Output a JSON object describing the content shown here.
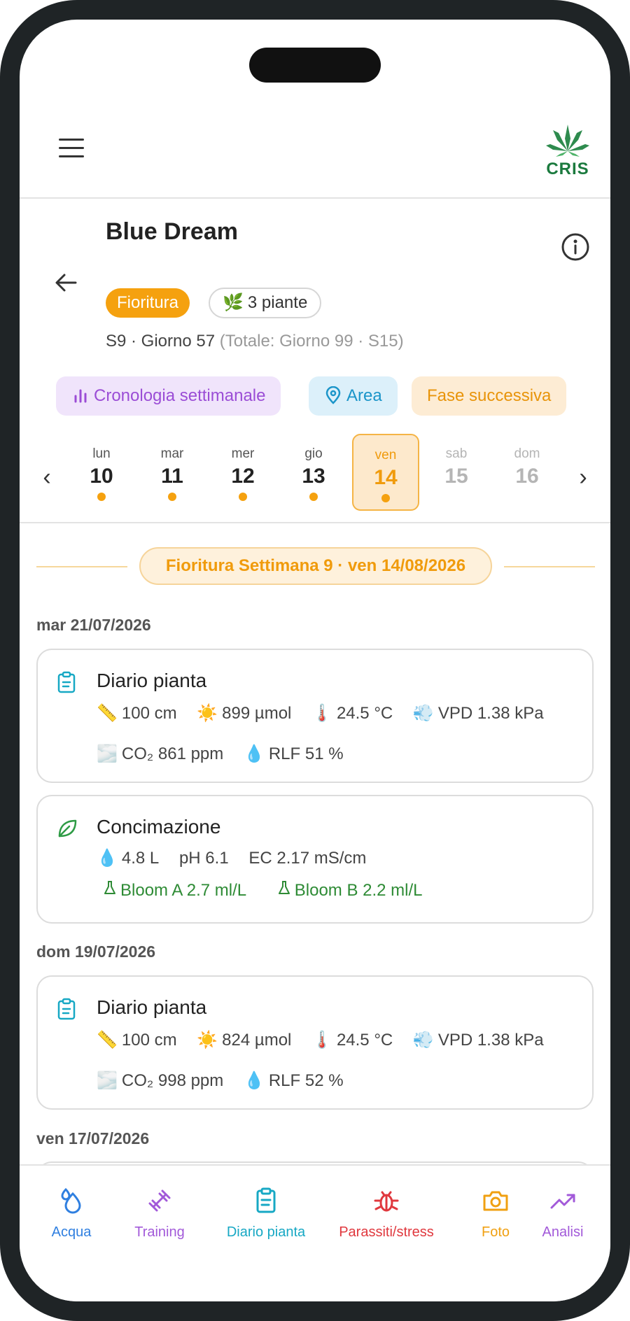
{
  "header": {
    "logo_text": "CRIS",
    "plant_name": "Blue Dream",
    "phase_badge": "Fioritura",
    "plants_badge": "3 piante",
    "plants_badge_emoji": "🌿",
    "day_info": "S9 · Giorno 57",
    "day_info_total": "(Totale: Giorno 99 · S15)"
  },
  "chips": {
    "timeline": "Cronologia settimanale",
    "area": "Area",
    "next_phase": "Fase successiva"
  },
  "week": {
    "prev_arrow": "‹",
    "next_arrow": "›",
    "days": [
      {
        "name": "lun",
        "num": "10",
        "has_entry": true
      },
      {
        "name": "mar",
        "num": "11",
        "has_entry": true
      },
      {
        "name": "mer",
        "num": "12",
        "has_entry": true
      },
      {
        "name": "gio",
        "num": "13",
        "has_entry": true
      },
      {
        "name": "ven",
        "num": "14",
        "has_entry": true,
        "selected": true
      },
      {
        "name": "sab",
        "num": "15",
        "has_entry": false
      },
      {
        "name": "dom",
        "num": "16",
        "has_entry": false
      }
    ]
  },
  "feed": {
    "week_banner": "Fioritura Settimana 9 · ven 14/08/2026",
    "groups": [
      {
        "date": "mar 21/07/2026",
        "entries": [
          {
            "title": "Diario pianta",
            "icon": "clipboard-icon",
            "height": "100 cm",
            "light": "899 µmol",
            "temp": "24.5 °C",
            "vpd": "VPD 1.38 kPa",
            "co2": "CO₂ 861 ppm",
            "rh": "RLF 51 %"
          },
          {
            "title": "Concimazione",
            "icon": "leaf-icon",
            "volume": "4.8 L",
            "ph": "pH 6.1",
            "ec": "EC 2.17 mS/cm",
            "nutrient_a": "Bloom A 2.7 ml/L",
            "nutrient_b": "Bloom B 2.2 ml/L"
          }
        ]
      },
      {
        "date": "dom 19/07/2026",
        "entries": [
          {
            "title": "Diario pianta",
            "icon": "clipboard-icon",
            "height": "100 cm",
            "light": "824 µmol",
            "temp": "24.5 °C",
            "vpd": "VPD 1.38 kPa",
            "co2": "CO₂ 998 ppm",
            "rh": "RLF 52 %"
          }
        ]
      },
      {
        "date": "ven 17/07/2026"
      }
    ],
    "emoji": {
      "ruler": "📏",
      "sun": "☀️",
      "thermo": "🌡️",
      "wind": "💨",
      "fog": "🌫️",
      "drop": "💧"
    }
  },
  "bottom_nav": [
    {
      "label": "Acqua",
      "color": "#2f7fe0"
    },
    {
      "label": "Training",
      "color": "#a259d9"
    },
    {
      "label": "Diario pianta",
      "color": "#17a8c4"
    },
    {
      "label": "Parassiti/stress",
      "color": "#e0383e"
    },
    {
      "label": "Foto",
      "color": "#f0a012"
    },
    {
      "label": "Analisi",
      "color": "#a259d9"
    }
  ],
  "colors": {
    "accent_orange": "#f5a10f",
    "timeline_purple": "#9b4dd6",
    "area_blue": "#1b95c9",
    "nutrient_green": "#2e8b35"
  }
}
